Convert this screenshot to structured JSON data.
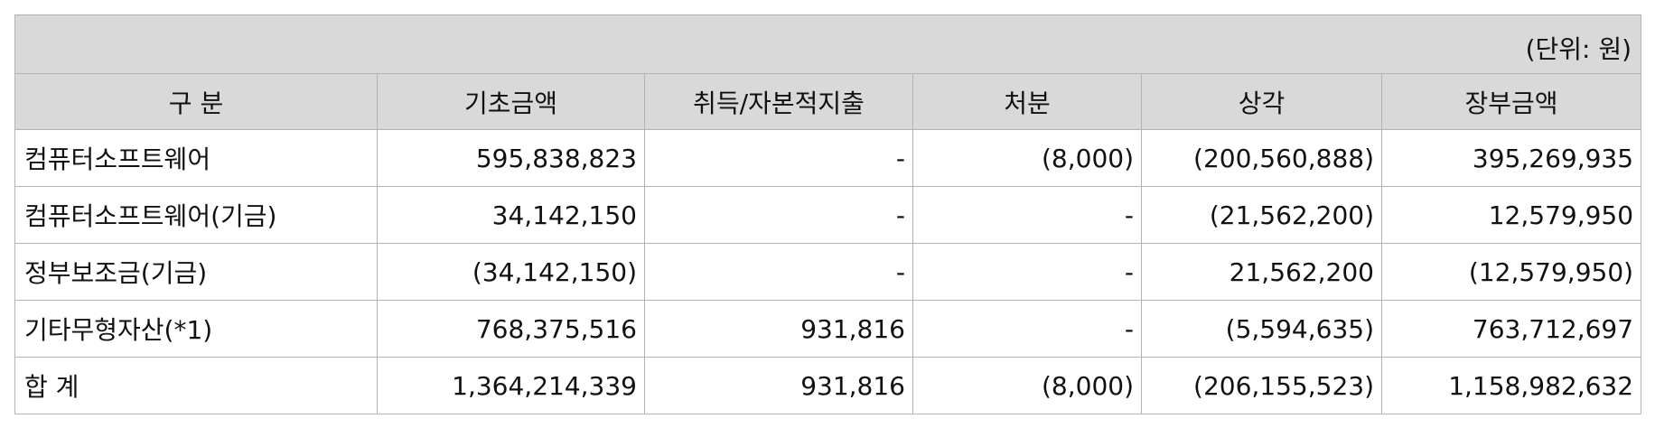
{
  "unit_label": "(단위: 원)",
  "headers": [
    "구  분",
    "기초금액",
    "취득/자본적지출",
    "처분",
    "상각",
    "장부금액"
  ],
  "rows": [
    {
      "label": "컴퓨터소프트웨어",
      "cells": [
        "595,838,823",
        "-",
        "(8,000)",
        "(200,560,888)",
        "395,269,935"
      ]
    },
    {
      "label": "컴퓨터소프트웨어(기금)",
      "cells": [
        "34,142,150",
        "-",
        "-",
        "(21,562,200)",
        "12,579,950"
      ]
    },
    {
      "label": "정부보조금(기금)",
      "cells": [
        "(34,142,150)",
        "-",
        "-",
        "21,562,200",
        "(12,579,950)"
      ]
    },
    {
      "label": "기타무형자산(*1)",
      "cells": [
        "768,375,516",
        "931,816",
        "-",
        "(5,594,635)",
        "763,712,697"
      ]
    },
    {
      "label": "합  계",
      "cells": [
        "1,364,214,339",
        "931,816",
        "(8,000)",
        "(206,155,523)",
        "1,158,982,632"
      ]
    }
  ]
}
